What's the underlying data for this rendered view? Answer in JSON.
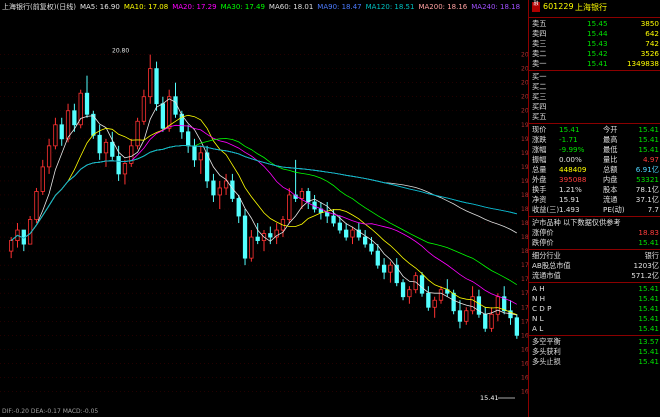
{
  "ma_legend": [
    {
      "label": "上海银行(前复权)(日线)",
      "color": "#e0e0e0"
    },
    {
      "label": "MA5: 16.90",
      "color": "#e8e8e8"
    },
    {
      "label": "MA10: 17.08",
      "color": "#ffff00"
    },
    {
      "label": "MA20: 17.29",
      "color": "#ff00ff"
    },
    {
      "label": "MA30: 17.49",
      "color": "#00ff00"
    },
    {
      "label": "MA60: 18.01",
      "color": "#dddddd"
    },
    {
      "label": "MA90: 18.47",
      "color": "#4b7bff"
    },
    {
      "label": "MA120: 18.51",
      "color": "#00c0c0"
    },
    {
      "label": "MA200: 18.16",
      "color": "#ffa0a0"
    },
    {
      "label": "MA240: 18.18",
      "color": "#a050ff"
    }
  ],
  "chart_data": {
    "type": "candlestick",
    "y_ticks": [
      "20.80",
      "20.60",
      "20.40",
      "20.20",
      "20.00",
      "19.80",
      "19.60",
      "19.40",
      "19.20",
      "19.00",
      "18.80",
      "18.60",
      "18.40",
      "18.20",
      "18.00",
      "17.80",
      "17.60",
      "17.40",
      "17.20",
      "17.00",
      "16.80",
      "16.60",
      "16.40",
      "16.20",
      "16.00"
    ],
    "ylim": [
      15.85,
      21.35
    ],
    "high_label": "20.80",
    "last_price_label": "15.41",
    "candles": [
      [
        18.0,
        18.2,
        17.9,
        18.15
      ],
      [
        18.15,
        18.4,
        18.05,
        18.3
      ],
      [
        18.3,
        18.3,
        18.0,
        18.1
      ],
      [
        18.1,
        18.5,
        18.1,
        18.45
      ],
      [
        18.45,
        18.9,
        18.4,
        18.85
      ],
      [
        18.85,
        19.3,
        18.8,
        19.2
      ],
      [
        19.2,
        19.6,
        19.1,
        19.5
      ],
      [
        19.5,
        19.9,
        19.45,
        19.8
      ],
      [
        19.8,
        19.9,
        19.5,
        19.6
      ],
      [
        19.6,
        20.1,
        19.55,
        20.0
      ],
      [
        20.0,
        20.1,
        19.7,
        19.8
      ],
      [
        19.8,
        20.3,
        19.75,
        20.25
      ],
      [
        20.25,
        20.5,
        19.9,
        19.95
      ],
      [
        19.95,
        20.0,
        19.6,
        19.65
      ],
      [
        19.65,
        19.8,
        19.3,
        19.4
      ],
      [
        19.4,
        19.6,
        19.2,
        19.55
      ],
      [
        19.55,
        19.7,
        19.3,
        19.35
      ],
      [
        19.35,
        19.5,
        19.0,
        19.1
      ],
      [
        19.1,
        19.3,
        18.95,
        19.25
      ],
      [
        19.25,
        19.6,
        19.2,
        19.5
      ],
      [
        19.5,
        19.9,
        19.45,
        19.85
      ],
      [
        19.85,
        20.3,
        19.8,
        20.2
      ],
      [
        20.2,
        20.8,
        20.1,
        20.6
      ],
      [
        20.6,
        20.7,
        20.0,
        20.1
      ],
      [
        20.1,
        20.2,
        19.7,
        19.75
      ],
      [
        19.75,
        20.3,
        19.7,
        20.2
      ],
      [
        20.2,
        20.4,
        19.9,
        19.95
      ],
      [
        19.95,
        20.0,
        19.6,
        19.7
      ],
      [
        19.7,
        19.8,
        19.4,
        19.5
      ],
      [
        19.5,
        19.6,
        19.2,
        19.3
      ],
      [
        19.3,
        19.5,
        19.1,
        19.4
      ],
      [
        19.4,
        19.5,
        18.9,
        19.0
      ],
      [
        19.0,
        19.1,
        18.7,
        18.8
      ],
      [
        18.8,
        19.0,
        18.6,
        18.9
      ],
      [
        18.9,
        19.1,
        18.8,
        19.0
      ],
      [
        19.0,
        19.1,
        18.7,
        18.75
      ],
      [
        18.75,
        18.8,
        18.4,
        18.5
      ],
      [
        18.5,
        18.6,
        17.8,
        17.9
      ],
      [
        17.9,
        18.3,
        17.85,
        18.2
      ],
      [
        18.2,
        18.4,
        18.1,
        18.15
      ],
      [
        18.15,
        18.3,
        18.0,
        18.25
      ],
      [
        18.25,
        18.35,
        18.1,
        18.2
      ],
      [
        18.2,
        18.4,
        18.1,
        18.3
      ],
      [
        18.3,
        18.5,
        18.2,
        18.45
      ],
      [
        18.45,
        18.9,
        18.4,
        18.8
      ],
      [
        18.8,
        19.3,
        18.7,
        18.75
      ],
      [
        18.75,
        18.9,
        18.6,
        18.85
      ],
      [
        18.85,
        18.9,
        18.6,
        18.7
      ],
      [
        18.7,
        18.8,
        18.55,
        18.6
      ],
      [
        18.6,
        18.7,
        18.45,
        18.55
      ],
      [
        18.55,
        18.7,
        18.4,
        18.5
      ],
      [
        18.5,
        18.6,
        18.35,
        18.4
      ],
      [
        18.4,
        18.5,
        18.25,
        18.3
      ],
      [
        18.3,
        18.4,
        18.15,
        18.2
      ],
      [
        18.2,
        18.35,
        18.1,
        18.3
      ],
      [
        18.3,
        18.4,
        18.15,
        18.2
      ],
      [
        18.2,
        18.3,
        18.05,
        18.1
      ],
      [
        18.1,
        18.2,
        17.95,
        18.0
      ],
      [
        18.0,
        18.1,
        17.75,
        17.8
      ],
      [
        17.8,
        17.9,
        17.6,
        17.7
      ],
      [
        17.7,
        17.85,
        17.55,
        17.8
      ],
      [
        17.8,
        17.9,
        17.5,
        17.55
      ],
      [
        17.55,
        17.6,
        17.3,
        17.35
      ],
      [
        17.35,
        17.5,
        17.25,
        17.45
      ],
      [
        17.45,
        17.7,
        17.4,
        17.65
      ],
      [
        17.65,
        17.7,
        17.35,
        17.4
      ],
      [
        17.4,
        17.5,
        17.15,
        17.2
      ],
      [
        17.2,
        17.35,
        17.05,
        17.3
      ],
      [
        17.3,
        17.5,
        17.25,
        17.45
      ],
      [
        17.45,
        17.6,
        17.35,
        17.4
      ],
      [
        17.4,
        17.45,
        17.1,
        17.15
      ],
      [
        17.15,
        17.3,
        16.9,
        17.0
      ],
      [
        17.0,
        17.2,
        16.95,
        17.15
      ],
      [
        17.15,
        17.5,
        17.1,
        17.35
      ],
      [
        17.35,
        17.45,
        17.05,
        17.1
      ],
      [
        17.1,
        17.2,
        16.85,
        16.9
      ],
      [
        16.9,
        17.2,
        16.85,
        17.1
      ],
      [
        17.1,
        17.4,
        17.0,
        17.35
      ],
      [
        17.35,
        17.5,
        17.1,
        17.15
      ],
      [
        17.15,
        17.3,
        16.95,
        17.05
      ],
      [
        17.05,
        17.1,
        16.75,
        16.8
      ]
    ]
  },
  "price_box": "15.41",
  "bottom_indicator": "DIF:-0.20  DEA:-0.17  MACD:-0.05",
  "panel": {
    "badge": "融",
    "code": "601229",
    "name": "上海银行",
    "asks": [
      {
        "label": "卖五",
        "price": "15.45",
        "vol": "3850"
      },
      {
        "label": "卖四",
        "price": "15.44",
        "vol": "642"
      },
      {
        "label": "卖三",
        "price": "15.43",
        "vol": "742"
      },
      {
        "label": "卖二",
        "price": "15.42",
        "vol": "3526"
      },
      {
        "label": "卖一",
        "price": "15.41",
        "vol": "1349838"
      }
    ],
    "bids": [
      {
        "label": "买一"
      },
      {
        "label": "买二"
      },
      {
        "label": "买三"
      },
      {
        "label": "买四"
      },
      {
        "label": "买五"
      }
    ],
    "stats": [
      {
        "l1": "现价",
        "v1": "15.41",
        "l2": "今开",
        "v2": "15.41",
        "c1": "grn",
        "c2": "grn"
      },
      {
        "l1": "涨跌",
        "v1": "-1.71",
        "l2": "最高",
        "v2": "15.41",
        "c1": "grn",
        "c2": "grn"
      },
      {
        "l1": "涨幅",
        "v1": "-9.99%",
        "l2": "最低",
        "v2": "15.41",
        "c1": "grn",
        "c2": "grn"
      },
      {
        "l1": "振幅",
        "v1": "0.00%",
        "l2": "量比",
        "v2": "4.97",
        "c1": "wht",
        "c2": "red"
      },
      {
        "l1": "总量",
        "v1": "448409",
        "l2": "总额",
        "v2": "6.91亿",
        "c1": "yel",
        "c2": "cyn"
      },
      {
        "l1": "外盘",
        "v1": "395088",
        "l2": "内盘",
        "v2": "53321",
        "c1": "red",
        "c2": "grn"
      },
      {
        "l1": "换手",
        "v1": "1.21%",
        "l2": "股本",
        "v2": "78.1亿",
        "c1": "wht",
        "c2": "wht"
      },
      {
        "l1": "净资",
        "v1": "15.91",
        "l2": "流通",
        "v2": "37.1亿",
        "c1": "wht",
        "c2": "wht"
      },
      {
        "l1": "收益(三)",
        "v1": "1.493",
        "l2": "PE(动)",
        "v2": "7.7",
        "c1": "wht",
        "c2": "wht"
      }
    ],
    "notice": "沪市品种 以下数据仅供参考",
    "limits": [
      {
        "l": "涨停价",
        "v": "18.83",
        "c": "red"
      },
      {
        "l": "跌停价",
        "v": "15.41",
        "c": "grn"
      }
    ],
    "industry": [
      {
        "l": "细分行业",
        "v": "银行"
      },
      {
        "l": "AB股总市值",
        "v": "1203亿"
      },
      {
        "l": "流通市值",
        "v": "571.2亿"
      }
    ],
    "ahn": [
      {
        "l": "A H",
        "v": "15.41"
      },
      {
        "l": "N H",
        "v": "15.41"
      },
      {
        "l": "C D P",
        "v": "15.41"
      },
      {
        "l": "N L",
        "v": "15.41"
      },
      {
        "l": "A L",
        "v": "15.41"
      }
    ],
    "signals": [
      {
        "l": "多空平衡",
        "v": "13.57",
        "c": "grn"
      },
      {
        "l": "多头获利",
        "v": "15.41",
        "c": "grn"
      },
      {
        "l": "多头止损",
        "v": "15.41",
        "c": "grn"
      }
    ]
  }
}
